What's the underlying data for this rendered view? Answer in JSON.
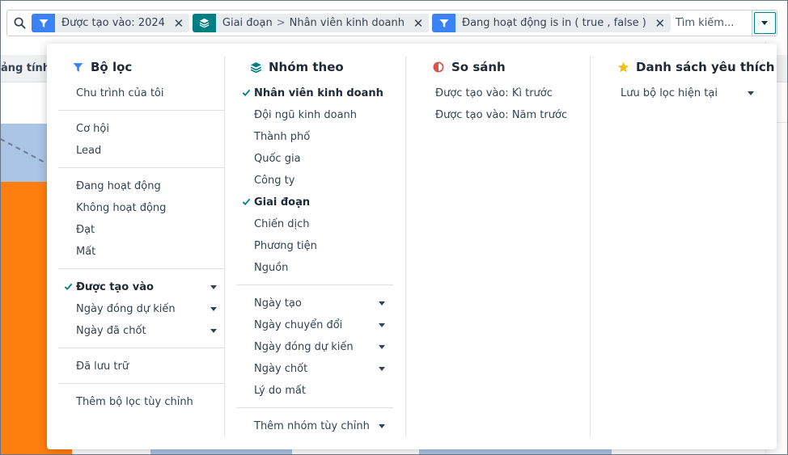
{
  "background": {
    "header_partial": "ảng tính"
  },
  "search": {
    "facets": [
      {
        "icon": "filter-icon",
        "label": "Được tạo vào: 2024"
      },
      {
        "icon": "layers-icon",
        "parts": [
          "Giai đoạn",
          ">",
          "Nhân viên kinh doanh"
        ]
      },
      {
        "icon": "filter-icon",
        "label": "Đang hoạt động is in ( true , false )"
      }
    ],
    "placeholder": "Tìm kiếm..."
  },
  "filters": {
    "title": "Bộ lọc",
    "groups": [
      [
        "Chu trình của tôi"
      ],
      [
        "Cơ hội",
        "Lead"
      ],
      [
        "Đang hoạt động",
        "Không hoạt động",
        "Đạt",
        "Mất"
      ],
      [
        "Được tạo vào",
        "Ngày đóng dự kiến",
        "Ngày đã chốt"
      ],
      [
        "Đã lưu trữ"
      ],
      [
        "Thêm bộ lọc tùy chỉnh"
      ]
    ]
  },
  "groupby": {
    "title": "Nhóm theo",
    "items": [
      "Nhân viên kinh doanh",
      "Đội ngũ kinh doanh",
      "Thành phố",
      "Quốc gia",
      "Công ty",
      "Giai đoạn",
      "Chiến dịch",
      "Phương tiện",
      "Nguồn"
    ],
    "date_items": [
      "Ngày tạo",
      "Ngày chuyển đổi",
      "Ngày đóng dự kiến",
      "Ngày chốt",
      "Lý do mất"
    ],
    "custom": "Thêm nhóm tùy chỉnh"
  },
  "compare": {
    "title": "So sánh",
    "items": [
      "Được tạo vào: Kì trước",
      "Được tạo vào: Năm trước"
    ]
  },
  "favorites": {
    "title": "Danh sách yêu thích",
    "items": [
      "Lưu bộ lọc hiện tại"
    ]
  },
  "colors": {
    "accent_teal": "#017e84",
    "filter_blue": "#3b82f6",
    "compare_red": "#d9534f",
    "star_yellow": "#f3c00d"
  }
}
